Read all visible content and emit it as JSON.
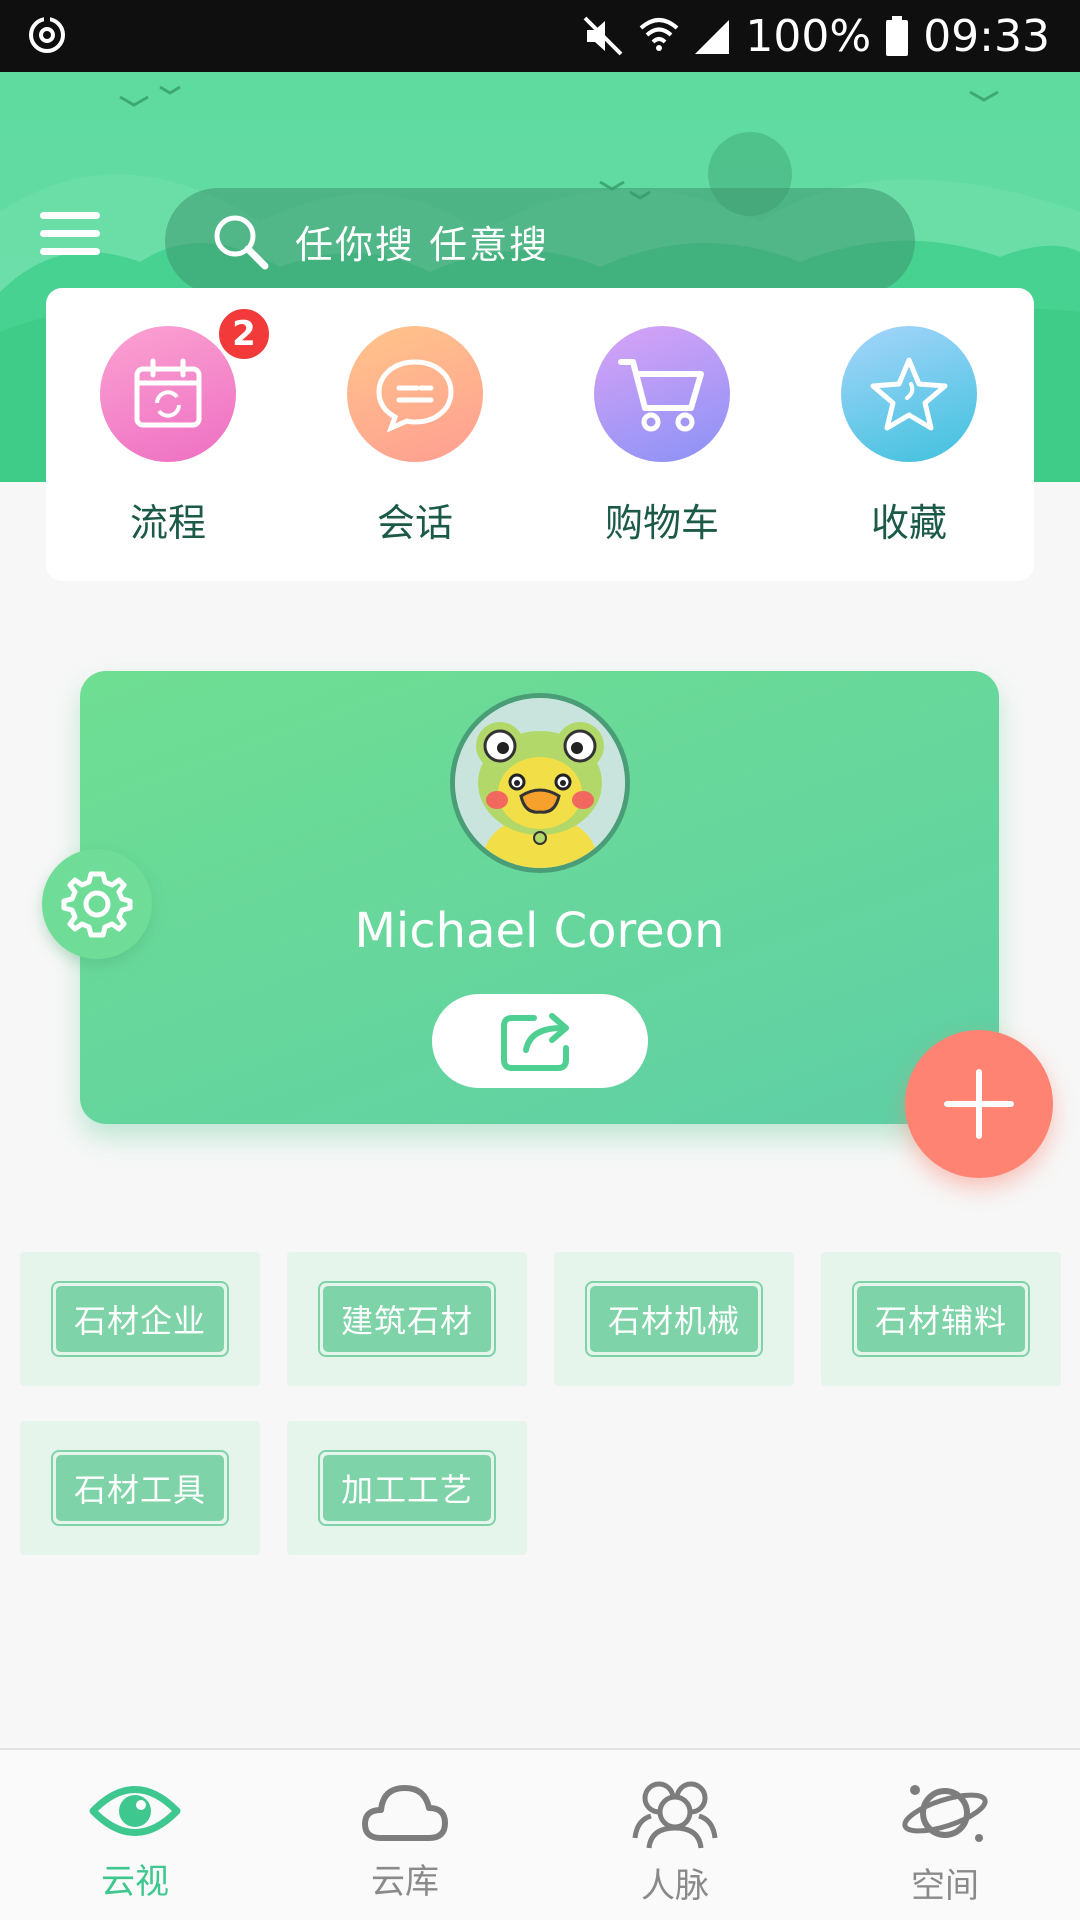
{
  "status_bar": {
    "battery": "100%",
    "time": "09:33",
    "icons": [
      "sync-icon",
      "mute-icon",
      "wifi-icon",
      "signal-icon",
      "battery-icon"
    ]
  },
  "header": {
    "menu_icon": "hamburger-icon",
    "search_placeholder": "任你搜   任意搜",
    "search_icon": "search-icon"
  },
  "quick_actions": [
    {
      "label": "流程",
      "icon": "calendar-refresh-icon",
      "badge": "2",
      "color": "#f07ec8"
    },
    {
      "label": "会话",
      "icon": "chat-bubble-icon",
      "badge": "",
      "color": "#ffad8c"
    },
    {
      "label": "购物车",
      "icon": "cart-icon",
      "badge": "",
      "color": "#a89af5"
    },
    {
      "label": "收藏",
      "icon": "star-icon",
      "badge": "",
      "color": "#6fcbed"
    }
  ],
  "profile": {
    "name": "Michael Coreon",
    "avatar": "frog-duck-avatar",
    "share_icon": "share-icon",
    "settings_icon": "gear-icon",
    "add_icon": "plus-icon"
  },
  "categories": [
    "石材企业",
    "建筑石材",
    "石材机械",
    "石材辅料",
    "石材工具",
    "加工工艺"
  ],
  "bottom_nav": [
    {
      "label": "云视",
      "icon": "eye-icon",
      "active": true
    },
    {
      "label": "云库",
      "icon": "cloud-icon",
      "active": false
    },
    {
      "label": "人脉",
      "icon": "people-icon",
      "active": false
    },
    {
      "label": "空间",
      "icon": "planet-icon",
      "active": false
    }
  ],
  "colors": {
    "accent": "#5fdba0",
    "fab": "#fe8373",
    "badge": "#f23a3a",
    "nav_active": "#3ec78e"
  }
}
